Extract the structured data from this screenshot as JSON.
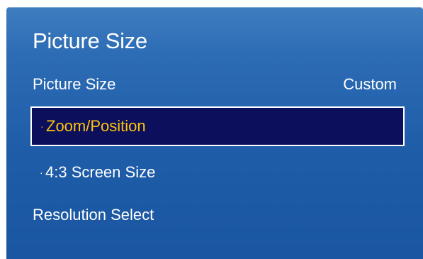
{
  "panel": {
    "title": "Picture Size"
  },
  "menu": {
    "picture_size": {
      "label": "Picture Size",
      "value": "Custom"
    },
    "zoom_position": {
      "bullet": "·",
      "label": "Zoom/Position"
    },
    "screen_size": {
      "bullet": "·",
      "label": "4:3 Screen Size"
    },
    "resolution": {
      "label": "Resolution Select"
    }
  },
  "colors": {
    "panel_blue": "#1f5da8",
    "selected_bg": "#0b0f5c",
    "selected_text": "#ffc20e",
    "text": "#ffffff"
  }
}
